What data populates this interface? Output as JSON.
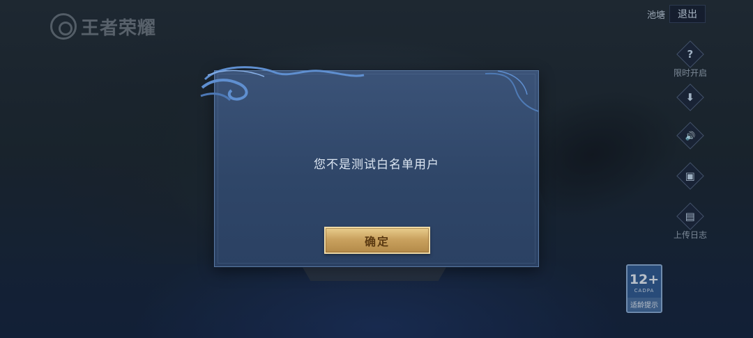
{
  "logo": {
    "text": "王者荣耀"
  },
  "top_bar": {
    "pool_label": "池塘",
    "logout_label": "退出"
  },
  "side_menu": [
    {
      "icon": "question-icon",
      "glyph": "?",
      "label": "限时开启"
    },
    {
      "icon": "download-icon",
      "glyph": "⬇",
      "label": ""
    },
    {
      "icon": "speaker-icon",
      "glyph": "🔊",
      "label": ""
    },
    {
      "icon": "device-icon",
      "glyph": "▣",
      "label": ""
    },
    {
      "icon": "log-upload-icon",
      "glyph": "▤",
      "label": "上传日志"
    }
  ],
  "age_badge": {
    "rating": "12+",
    "org": "CADPA",
    "tip": "适龄提示"
  },
  "dialog": {
    "message": "您不是测试白名单用户",
    "confirm_label": "确定"
  },
  "colors": {
    "dialog_bg": "#2f4668",
    "confirm_gold": "#caa25f",
    "text_light": "#dde7f3"
  }
}
